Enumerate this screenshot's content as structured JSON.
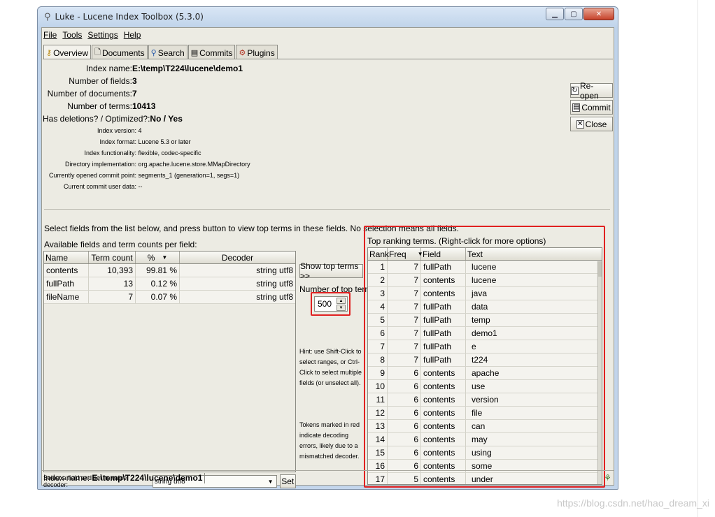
{
  "window": {
    "title": "Luke - Lucene Index Toolbox (5.3.0)"
  },
  "menu": [
    "File",
    "Tools",
    "Settings",
    "Help"
  ],
  "tabs": [
    {
      "label": "Overview",
      "icon": "key-icon"
    },
    {
      "label": "Documents",
      "icon": "document-icon"
    },
    {
      "label": "Search",
      "icon": "search-icon"
    },
    {
      "label": "Commits",
      "icon": "commits-icon"
    },
    {
      "label": "Plugins",
      "icon": "plugins-icon"
    }
  ],
  "overview": {
    "index_name_label": "Index name:",
    "index_name": "E:\\temp\\T224\\lucene\\demo1",
    "num_fields_label": "Number of fields:",
    "num_fields": "3",
    "num_docs_label": "Number of documents:",
    "num_docs": "7",
    "num_terms_label": "Number of terms:",
    "num_terms": "10413",
    "deletions_label": "Has deletions? / Optimized?:",
    "deletions": "No / Yes",
    "index_version_label": "Index version:",
    "index_version": "4",
    "index_format_label": "Index format:",
    "index_format": "Lucene 5.3 or later",
    "functionality_label": "Index functionality:",
    "functionality": "flexible, codec-specific",
    "dir_impl_label": "Directory implementation:",
    "dir_impl": "org.apache.lucene.store.MMapDirectory",
    "commit_point_label": "Currently opened commit point:",
    "commit_point": "segments_1 (generation=1, segs=1)",
    "commit_user_label": "Current commit user data:",
    "commit_user": "--"
  },
  "side_buttons": {
    "reopen": "Re-open",
    "commit": "Commit",
    "close": "Close"
  },
  "select_hint": "Select fields from the list below, and press button to view top terms in these fields. No selection means all fields.",
  "fields": {
    "label": "Available fields and term counts per field:",
    "headers": [
      "Name",
      "Term count",
      "%",
      "Decoder"
    ],
    "rows": [
      [
        "contents",
        "10,393",
        "99.81 %",
        "string utf8"
      ],
      [
        "fullPath",
        "13",
        "0.12 %",
        "string utf8"
      ],
      [
        "fileName",
        "7",
        "0.07 %",
        "string utf8"
      ]
    ],
    "decoder_label": "Select a field and set its value decoder:",
    "decoder_value": "string utf8",
    "set_label": "Set"
  },
  "controls": {
    "show_top_terms": "Show top terms >>",
    "num_top_terms_label": "Number of top terms:",
    "num_top_terms": "500",
    "hint1": "Hint: use Shift-Click to select ranges, or Ctrl-Click to select multiple fields (or unselect all).",
    "hint2": "Tokens marked in red indicate decoding errors, likely due to a mismatched decoder."
  },
  "top_terms": {
    "label": "Top ranking terms. (Right-click for more options)",
    "headers": [
      "Rank",
      "Freq",
      "Field",
      "Text"
    ],
    "rows": [
      [
        "1",
        "7",
        "fullPath",
        "lucene"
      ],
      [
        "2",
        "7",
        "contents",
        "lucene"
      ],
      [
        "3",
        "7",
        "contents",
        "java"
      ],
      [
        "4",
        "7",
        "fullPath",
        "data"
      ],
      [
        "5",
        "7",
        "fullPath",
        "temp"
      ],
      [
        "6",
        "7",
        "fullPath",
        "demo1"
      ],
      [
        "7",
        "7",
        "fullPath",
        "e"
      ],
      [
        "8",
        "7",
        "fullPath",
        "t224"
      ],
      [
        "9",
        "6",
        "contents",
        "apache"
      ],
      [
        "10",
        "6",
        "contents",
        "use"
      ],
      [
        "11",
        "6",
        "contents",
        "version"
      ],
      [
        "12",
        "6",
        "contents",
        "file"
      ],
      [
        "13",
        "6",
        "contents",
        "can"
      ],
      [
        "14",
        "6",
        "contents",
        "may"
      ],
      [
        "15",
        "6",
        "contents",
        "using"
      ],
      [
        "16",
        "6",
        "contents",
        "some"
      ],
      [
        "17",
        "5",
        "contents",
        "under"
      ]
    ]
  },
  "status": {
    "label": "Index name:",
    "value": "E:\\temp\\T224\\lucene\\demo1"
  },
  "watermark": "https://blog.csdn.net/hao_dream_xi",
  "colors": {
    "highlight_box": "#e02020",
    "panel_bg": "#ecebe3",
    "title_bg": "#c3d5eb"
  }
}
